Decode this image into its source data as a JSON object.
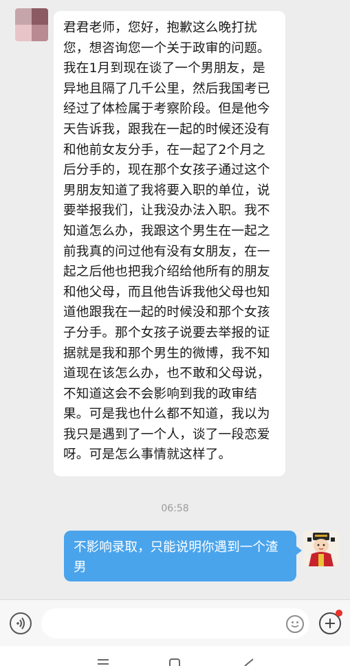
{
  "conversation": {
    "incoming_message": "君君老师，您好，抱歉这么晚打扰您，想咨询您一个关于政审的问题。我在1月到现在谈了一个男朋友，是异地且隔了几千公里，然后我国考已经过了体检属于考察阶段。但是他今天告诉我，跟我在一起的时候还没有和他前女友分手，在一起了2个月之后分手的，现在那个女孩子通过这个男朋友知道了我将要入职的单位，说要举报我们，让我没办法入职。我不知道怎么办，我跟这个男生在一起之前我真的问过他有没有女朋友，在一起之后他也把我介绍给他所有的朋友和他父母，而且他告诉我他父母也知道他跟我在一起的时候没和那个女孩子分手。那个女孩子说要去举报的证据就是我和那个男生的微博，我不知道现在该怎么办，也不敢和父母说，不知道这会不会影响到我的政审结果。可是我也什么都不知道，我以为我只是遇到了一个人，谈了一段恋爱呀。可是怎么事情就这样了。",
    "timestamp": "06:58",
    "outgoing_message": "不影响录取，只能说明你遇到一个渣男"
  },
  "icons": {
    "voice": "voice-input-icon",
    "emoji": "emoji-icon",
    "more": "plus-icon",
    "nav_menu": "menu-icon",
    "nav_home": "home-icon",
    "nav_back": "back-icon"
  },
  "colors": {
    "chat_background": "#ededed",
    "incoming_bubble": "#ffffff",
    "outgoing_bubble": "#4aa4ec",
    "notification_dot": "#e8322a"
  }
}
